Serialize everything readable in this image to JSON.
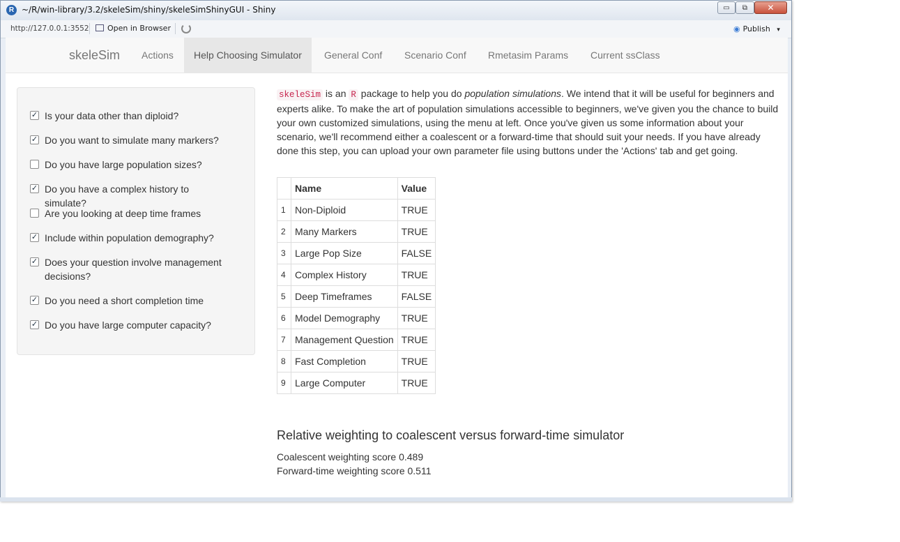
{
  "window": {
    "title": "~/R/win-library/3.2/skeleSim/shiny/skeleSimShinyGUI - Shiny",
    "app_icon_letter": "R",
    "minimize_glyph": "▭",
    "maximize_glyph": "⧉",
    "close_glyph": "✕"
  },
  "toolbar": {
    "url": "http://127.0.0.1:3552",
    "open_in_browser": "Open in Browser",
    "publish": "Publish",
    "publish_caret": "▾",
    "publish_glyph": "◉"
  },
  "navbar": {
    "brand": "skeleSim",
    "items": [
      {
        "label": "Actions"
      },
      {
        "label": "Help Choosing Simulator",
        "active": true
      },
      {
        "label": "General Conf"
      },
      {
        "label": "Scenario Conf"
      },
      {
        "label": "Rmetasim Params"
      },
      {
        "label": "Current ssClass"
      }
    ]
  },
  "sidebar": {
    "checkboxes": [
      {
        "label": "Is your data other than diploid?",
        "checked": true
      },
      {
        "label": "Do you want to simulate many markers?",
        "checked": true
      },
      {
        "label": "Do you have large population sizes?",
        "checked": false
      },
      {
        "label": "Do you have a complex history to simulate?",
        "checked": true
      },
      {
        "label": "Are you looking at deep time frames",
        "checked": false
      },
      {
        "label": "Include within population demography?",
        "checked": true
      },
      {
        "label": "Does your question involve management decisions?",
        "checked": true
      },
      {
        "label": "Do you need a short completion time",
        "checked": true
      },
      {
        "label": "Do you have large computer capacity?",
        "checked": true
      }
    ]
  },
  "intro": {
    "code_skelesim": "skeleSim",
    "text_1": " is an ",
    "code_r": "R",
    "text_2": " package to help you do ",
    "emph": "population simulations",
    "text_3": ". We intend that it will be useful for beginners and experts alike. To make the art of population simulations accessible to beginners, we've given you the chance to build your own customized simulations, using the menu at left. Once you've given us some information about your scenario, we'll recommend either a coalescent or a forward-time that should suit your needs. If you have already done this step, you can upload your own parameter file using buttons under the 'Actions' tab and get going."
  },
  "table": {
    "headers": [
      "",
      "Name",
      "Value"
    ],
    "rows": [
      [
        "1",
        "Non-Diploid",
        "TRUE"
      ],
      [
        "2",
        "Many Markers",
        "TRUE"
      ],
      [
        "3",
        "Large Pop Size",
        "FALSE"
      ],
      [
        "4",
        "Complex History",
        "TRUE"
      ],
      [
        "5",
        "Deep Timeframes",
        "FALSE"
      ],
      [
        "6",
        "Model Demography",
        "TRUE"
      ],
      [
        "7",
        "Management Question",
        "TRUE"
      ],
      [
        "8",
        "Fast Completion",
        "TRUE"
      ],
      [
        "9",
        "Large Computer",
        "TRUE"
      ]
    ]
  },
  "weighting": {
    "title": "Relative weighting to coalescent versus forward-time simulator",
    "coalescent": "Coalescent weighting score 0.489",
    "forward": "Forward-time weighting score 0.511"
  }
}
